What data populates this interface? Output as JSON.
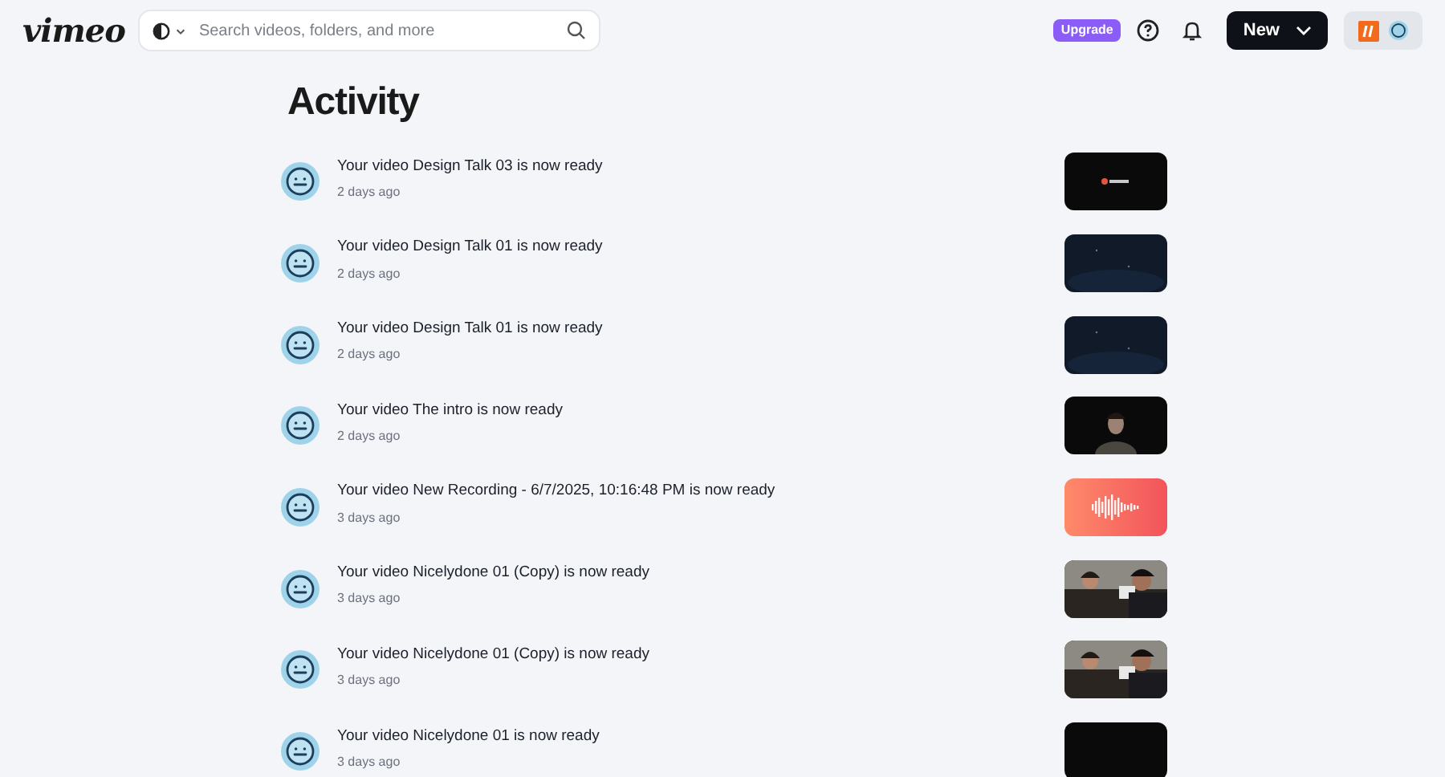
{
  "header": {
    "logo": "vimeo",
    "search": {
      "placeholder": "Search videos, folders, and more"
    },
    "upgrade": "Upgrade",
    "new_button": "New"
  },
  "page": {
    "title": "Activity"
  },
  "activity": [
    {
      "message": "Your video Design Talk 03 is now ready",
      "time": "2 days ago",
      "kind": "video"
    },
    {
      "message": "Your video Design Talk 01 is now ready",
      "time": "2 days ago",
      "kind": "video"
    },
    {
      "message": "Your video Design Talk 01 is now ready",
      "time": "2 days ago",
      "kind": "video"
    },
    {
      "message": "Your video The intro is now ready",
      "time": "2 days ago",
      "kind": "video"
    },
    {
      "message": "Your video New Recording - 6/7/2025, 10:16:48 PM is now ready",
      "time": "3 days ago",
      "kind": "audio"
    },
    {
      "message": "Your video Nicelydone 01 (Copy) is now ready",
      "time": "3 days ago",
      "kind": "video"
    },
    {
      "message": "Your video Nicelydone 01 (Copy) is now ready",
      "time": "3 days ago",
      "kind": "video"
    },
    {
      "message": "Your video Nicelydone 01 is now ready",
      "time": "3 days ago",
      "kind": "video"
    }
  ]
}
